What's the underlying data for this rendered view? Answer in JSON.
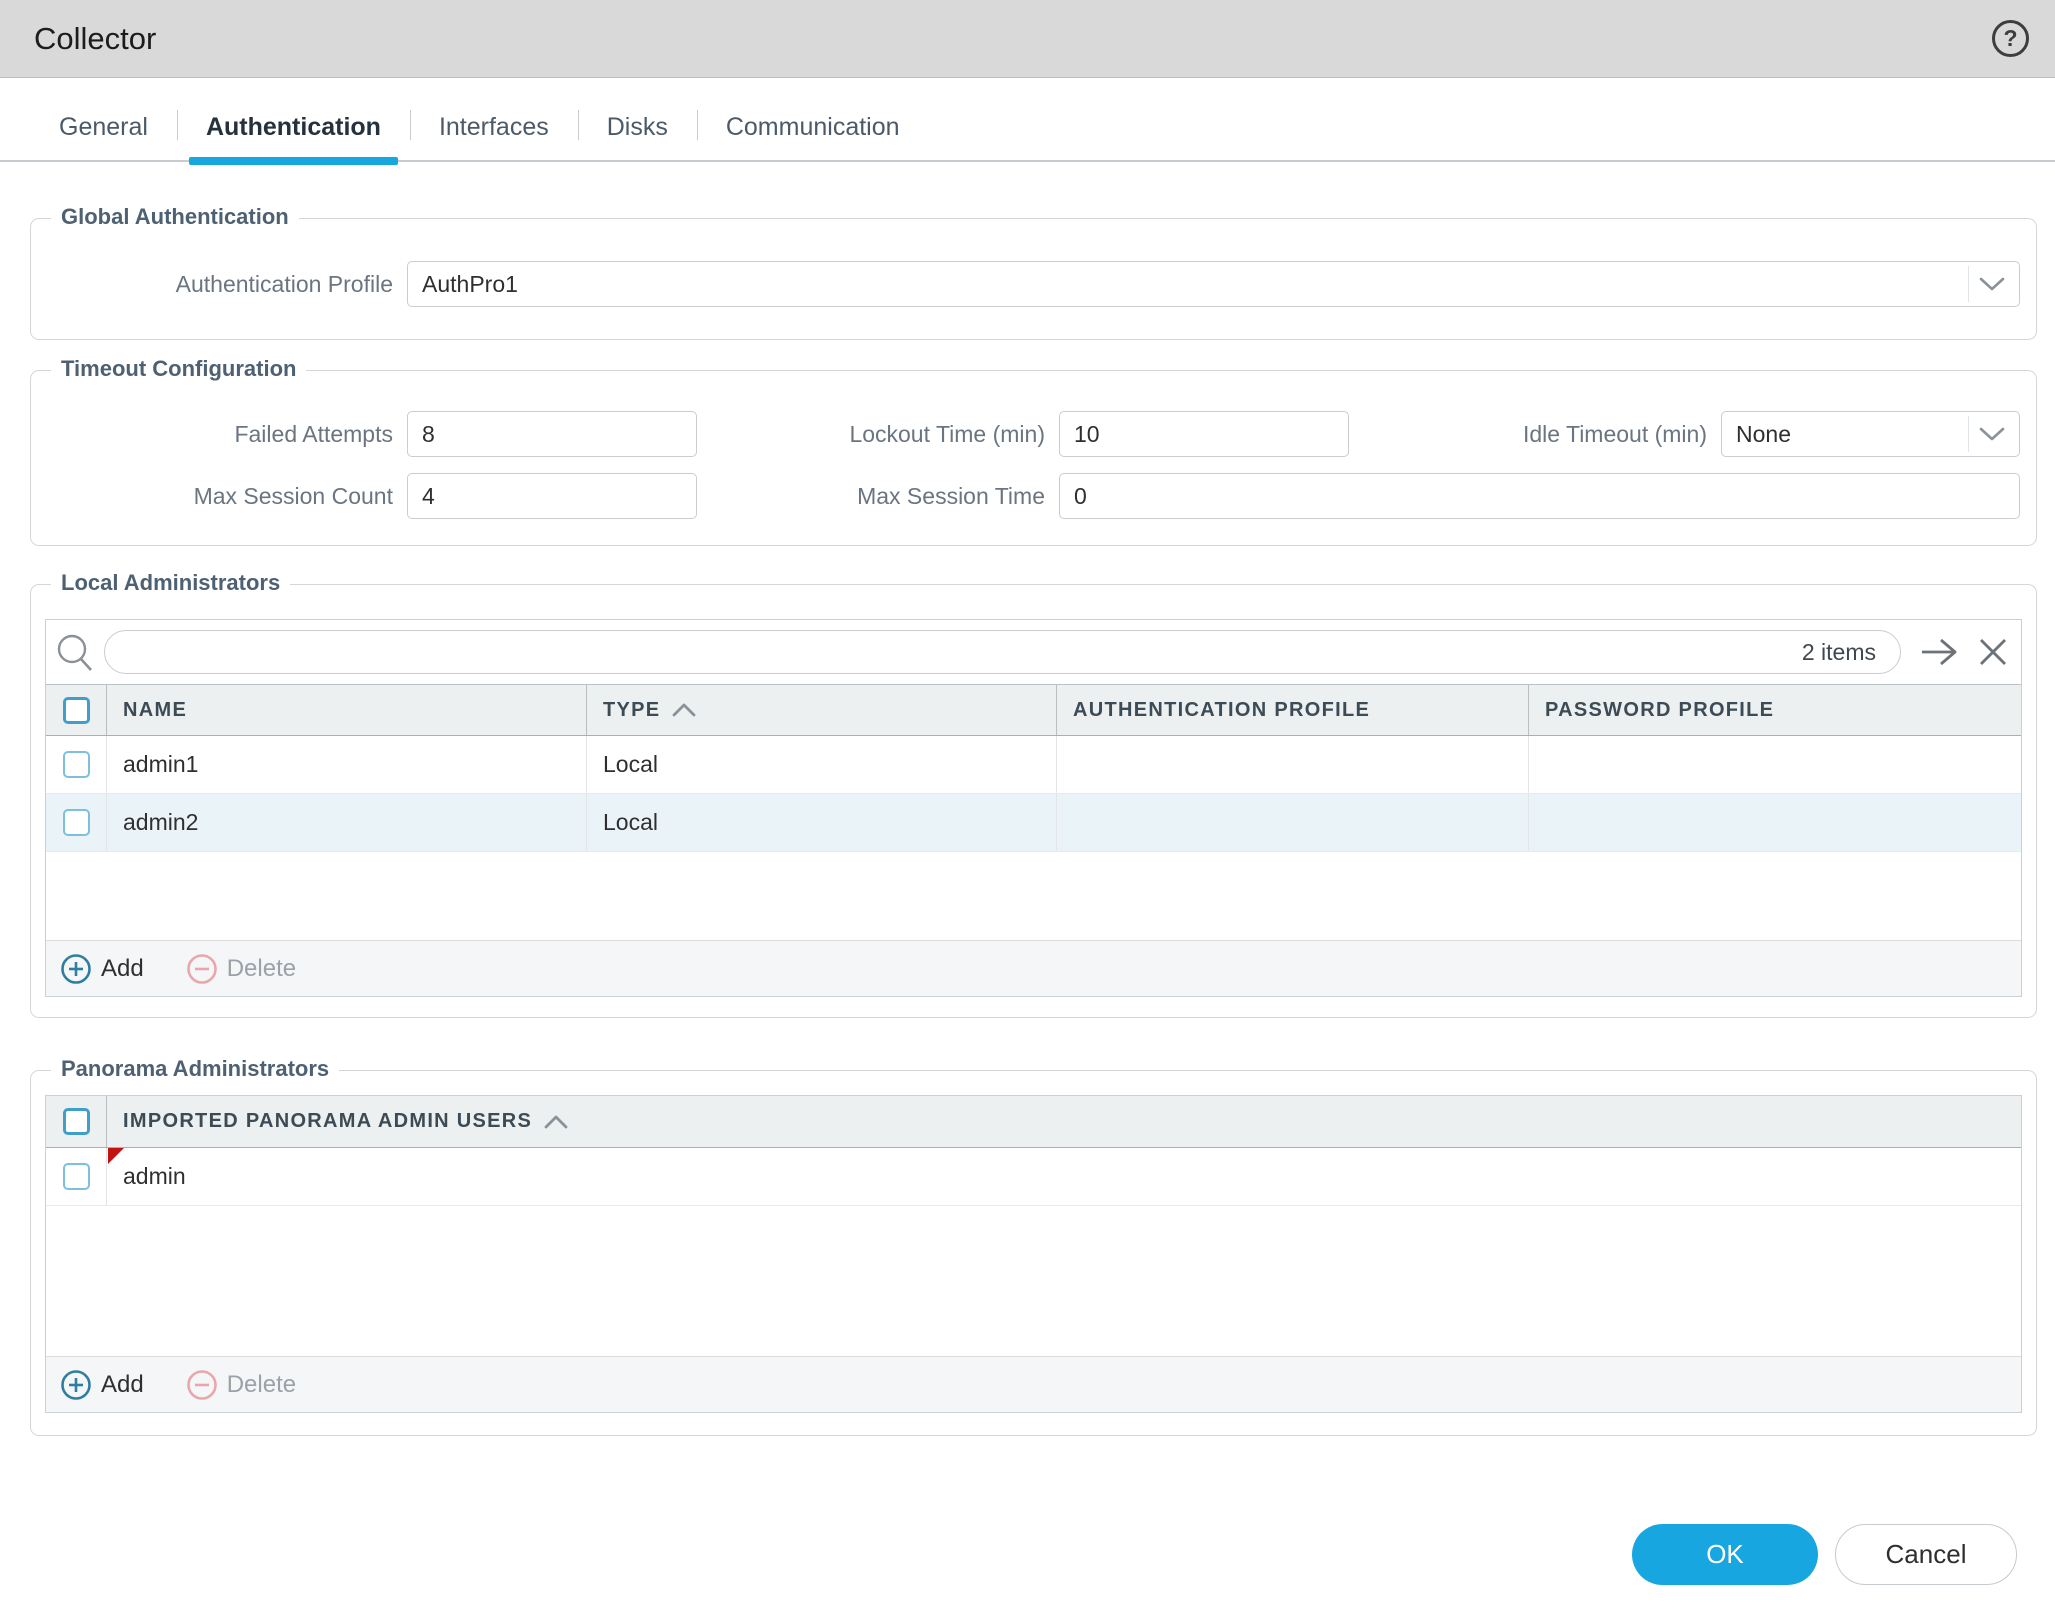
{
  "window": {
    "title": "Collector"
  },
  "tabs": [
    {
      "label": "General",
      "active": false
    },
    {
      "label": "Authentication",
      "active": true
    },
    {
      "label": "Interfaces",
      "active": false
    },
    {
      "label": "Disks",
      "active": false
    },
    {
      "label": "Communication",
      "active": false
    }
  ],
  "global_auth": {
    "legend": "Global Authentication",
    "profile_label": "Authentication Profile",
    "profile_value": "AuthPro1"
  },
  "timeout": {
    "legend": "Timeout Configuration",
    "failed_attempts": {
      "label": "Failed Attempts",
      "value": "8"
    },
    "lockout_time": {
      "label": "Lockout Time (min)",
      "value": "10"
    },
    "idle_timeout": {
      "label": "Idle Timeout (min)",
      "value": "None"
    },
    "max_session_count": {
      "label": "Max Session Count",
      "value": "4"
    },
    "max_session_time": {
      "label": "Max Session Time",
      "value": "0"
    }
  },
  "local_admins": {
    "legend": "Local Administrators",
    "search_value": "",
    "items_count": "2 items",
    "columns": [
      "NAME",
      "TYPE",
      "AUTHENTICATION PROFILE",
      "PASSWORD PROFILE"
    ],
    "rows": [
      {
        "name": "admin1",
        "type": "Local",
        "auth_profile": "",
        "password_profile": ""
      },
      {
        "name": "admin2",
        "type": "Local",
        "auth_profile": "",
        "password_profile": ""
      }
    ],
    "add_label": "Add",
    "delete_label": "Delete"
  },
  "panorama_admins": {
    "legend": "Panorama Administrators",
    "column": "IMPORTED PANORAMA ADMIN USERS",
    "rows": [
      {
        "name": "admin",
        "modified": true
      }
    ],
    "add_label": "Add",
    "delete_label": "Delete"
  },
  "actions": {
    "ok": "OK",
    "cancel": "Cancel"
  },
  "colors": {
    "accent": "#18a6e1",
    "title-bar": "#d9d9d9",
    "legend": "#4e6172",
    "row-alt": "#eaf3f8",
    "checkbox-strong": "#3f9fca",
    "add-icon": "#2f7ea1",
    "delete-icon": "#e9a7ad",
    "modified-flag": "#c41212"
  }
}
